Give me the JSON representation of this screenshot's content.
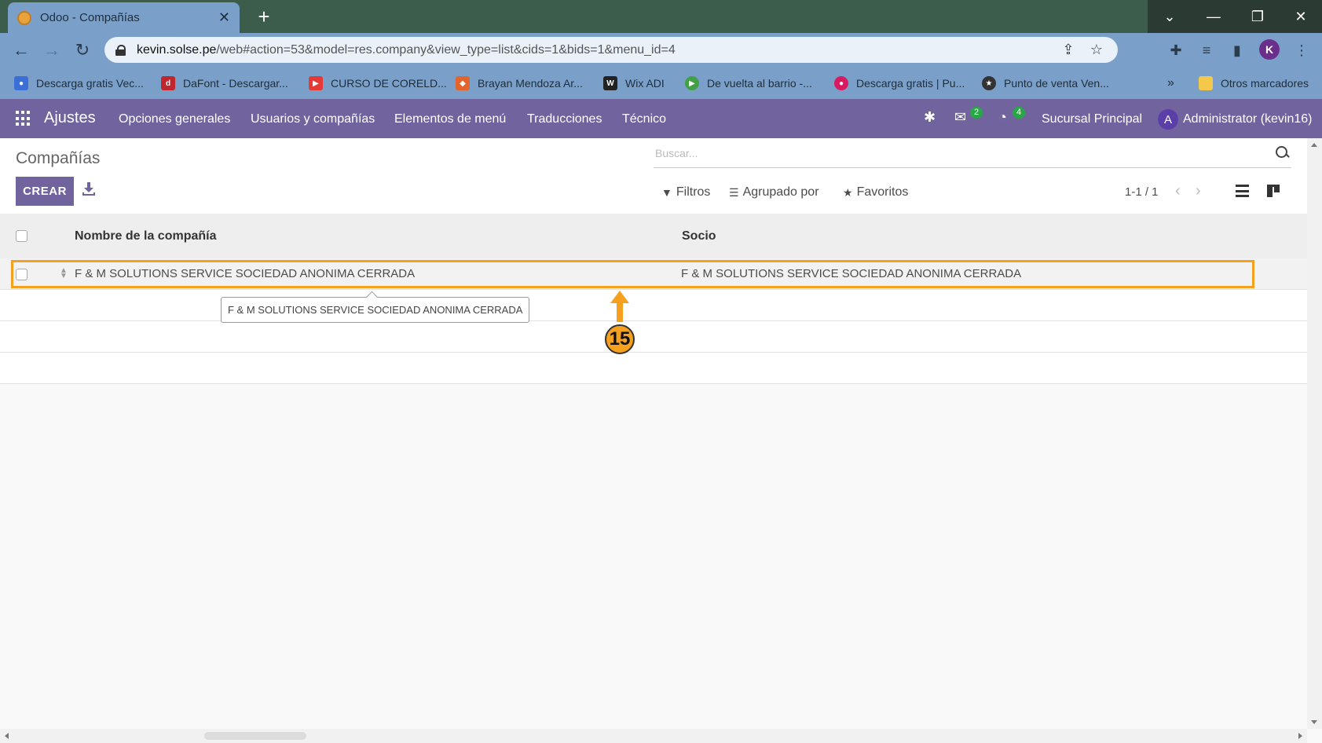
{
  "browser": {
    "tab_title": "Odoo - Compañías",
    "tab_close": "✕",
    "new_tab": "+",
    "url_host": "kevin.solse.pe",
    "url_path": "/web#action=53&model=res.company&view_type=list&cids=1&bids=1&menu_id=4",
    "profile_initial": "K",
    "bookmarks": [
      {
        "label": "Descarga gratis Vec...",
        "color": "#3b6fd6"
      },
      {
        "label": "DaFont - Descargar...",
        "color": "#c0262d"
      },
      {
        "label": "CURSO DE CORELD...",
        "color": "#e53935"
      },
      {
        "label": "Brayan Mendoza Ar...",
        "color": "#e2652e"
      },
      {
        "label": "Wix ADI",
        "color": "#222222"
      },
      {
        "label": "De vuelta al barrio -...",
        "color": "#43a047"
      },
      {
        "label": "Descarga gratis | Pu...",
        "color": "#d81b60"
      },
      {
        "label": "Punto de venta Ven...",
        "color": "#333333"
      }
    ],
    "bookmarks_more": "»",
    "other_bookmarks": "Otros marcadores"
  },
  "odoo_nav": {
    "app_name": "Ajustes",
    "menu": [
      "Opciones generales",
      "Usuarios y compañías",
      "Elementos de menú",
      "Traducciones",
      "Técnico"
    ],
    "messages_count": "2",
    "activities_count": "4",
    "branch": "Sucursal Principal",
    "user_initial": "A",
    "user": "Administrator (kevin16)"
  },
  "control_panel": {
    "breadcrumb": "Compañías",
    "create_label": "CREAR",
    "search_placeholder": "Buscar...",
    "filters_label": "Filtros",
    "group_by_label": "Agrupado por",
    "favorites_label": "Favoritos",
    "pager": "1-1 / 1"
  },
  "list": {
    "columns": [
      "Nombre de la compañía",
      "Socio"
    ],
    "rows": [
      {
        "name": "F & M SOLUTIONS SERVICE SOCIEDAD ANONIMA CERRADA",
        "partner": "F & M SOLUTIONS SERVICE SOCIEDAD ANONIMA CERRADA"
      }
    ],
    "tooltip": "F & M SOLUTIONS SERVICE SOCIEDAD ANONIMA CERRADA"
  },
  "annotation": {
    "step_number": "15",
    "accent_color": "#f5a11f"
  }
}
